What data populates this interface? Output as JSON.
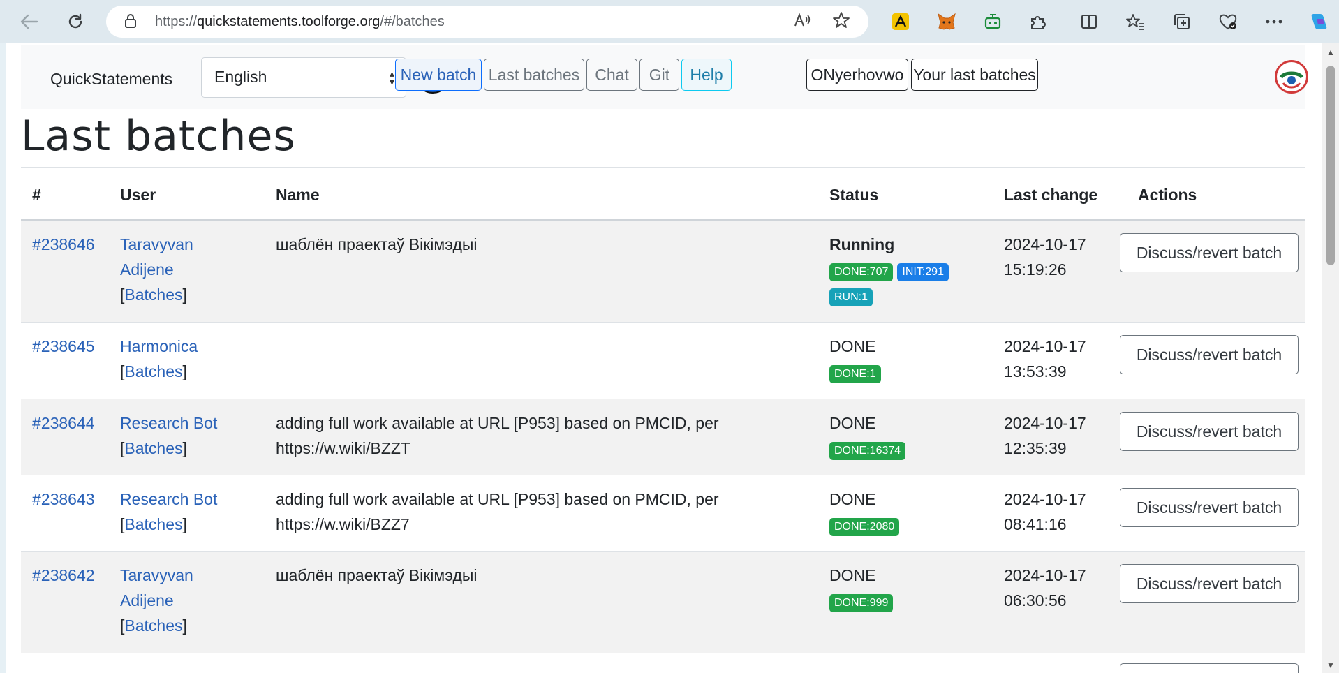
{
  "browser": {
    "url_prefix": "https://",
    "url_host": "quickstatements.toolforge.org",
    "url_path": "/#/batches"
  },
  "navbar": {
    "brand": "QuickStatements",
    "language": "English",
    "buttons": {
      "new_batch": "New batch",
      "last_batches": "Last batches",
      "chat": "Chat",
      "git": "Git",
      "help": "Help",
      "username": "ONyerhovwo",
      "your_last_batches": "Your last batches"
    }
  },
  "page_title": "Last batches",
  "table": {
    "headers": {
      "num": "#",
      "user": "User",
      "name": "Name",
      "status": "Status",
      "last_change": "Last change",
      "actions": "Actions"
    },
    "batches_link": "Batches",
    "action_label": "Discuss/revert batch",
    "rows": [
      {
        "id": "#238646",
        "user_line1": "Taravyvan",
        "user_line2": "Adijene",
        "name_line1": "шаблён праектаў Вікімэдыі",
        "name_line2": "",
        "status": "Running",
        "badges": [
          "DONE:707",
          "INIT:291",
          "RUN:1"
        ],
        "date": "2024-10-17",
        "time": "15:19:26"
      },
      {
        "id": "#238645",
        "user_line1": "Harmonica",
        "user_line2": "",
        "name_line1": "",
        "name_line2": "",
        "status": "DONE",
        "badges": [
          "DONE:1"
        ],
        "date": "2024-10-17",
        "time": "13:53:39"
      },
      {
        "id": "#238644",
        "user_line1": "Research Bot",
        "user_line2": "",
        "name_line1": "adding full work available at URL [P953] based on PMCID, per",
        "name_line2": "https://w.wiki/BZZT",
        "status": "DONE",
        "badges": [
          "DONE:16374"
        ],
        "date": "2024-10-17",
        "time": "12:35:39"
      },
      {
        "id": "#238643",
        "user_line1": "Research Bot",
        "user_line2": "",
        "name_line1": "adding full work available at URL [P953] based on PMCID, per",
        "name_line2": "https://w.wiki/BZZ7",
        "status": "DONE",
        "badges": [
          "DONE:2080"
        ],
        "date": "2024-10-17",
        "time": "08:41:16"
      },
      {
        "id": "#238642",
        "user_line1": "Taravyvan",
        "user_line2": "Adijene",
        "name_line1": "шаблён праектаў Вікімэдыі",
        "name_line2": "",
        "status": "DONE",
        "badges": [
          "DONE:999"
        ],
        "date": "2024-10-17",
        "time": "06:30:56"
      }
    ]
  },
  "colors": {
    "link": "#2a62b8",
    "badge_done": "#22a54a",
    "badge_init": "#1a7ee8",
    "badge_run": "#17a2b8"
  }
}
